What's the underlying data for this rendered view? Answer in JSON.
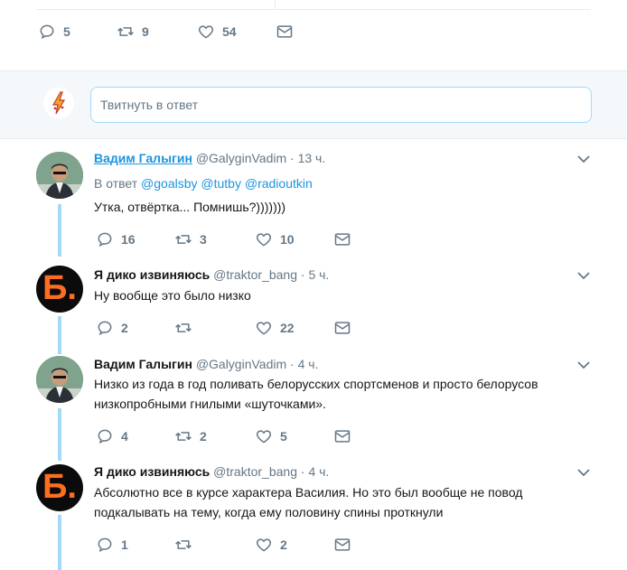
{
  "top_actions": {
    "replies": "5",
    "retweets": "9",
    "likes": "54"
  },
  "reply_box": {
    "placeholder": "Твитнуть в ответ"
  },
  "tweets": [
    {
      "name": "Вадим Галыгин",
      "handle": "@GalyginVadim",
      "separator": "·",
      "time": "13 ч.",
      "reply_prefix": "В ответ",
      "mentions": [
        "@goalsby",
        "@tutby",
        "@radioutkin"
      ],
      "text": "Утка, отвёртка... Помнишь?)))))))",
      "replies": "16",
      "retweets": "3",
      "likes": "10"
    },
    {
      "name": "Я дико извиняюсь",
      "handle": "@traktor_bang",
      "separator": "·",
      "time": "5 ч.",
      "avatar_letter": "Б.",
      "text": "Ну вообще это было низко",
      "replies": "2",
      "retweets": "",
      "likes": "22"
    },
    {
      "name": "Вадим Галыгин",
      "handle": "@GalyginVadim",
      "separator": "·",
      "time": "4 ч.",
      "text_line1": "Низко из года в год поливать белорусских спортсменов и просто белорусов",
      "text_line2": "низкопробными гнилыми «шуточками».",
      "replies": "4",
      "retweets": "2",
      "likes": "5"
    },
    {
      "name": "Я дико извиняюсь",
      "handle": "@traktor_bang",
      "separator": "·",
      "time": "4 ч.",
      "avatar_letter": "Б.",
      "text_line1": "Абсолютно все в курсе характера Василия. Но это был вообще не повод",
      "text_line2": "подкалывать на тему, когда ему половину спины проткнули",
      "replies": "1",
      "retweets": "",
      "likes": "2"
    }
  ],
  "colors": {
    "accent": "#1b95e0",
    "thread": "#a4d9f9",
    "muted": "#657786",
    "avatar_letter": "#ff6d1f"
  }
}
